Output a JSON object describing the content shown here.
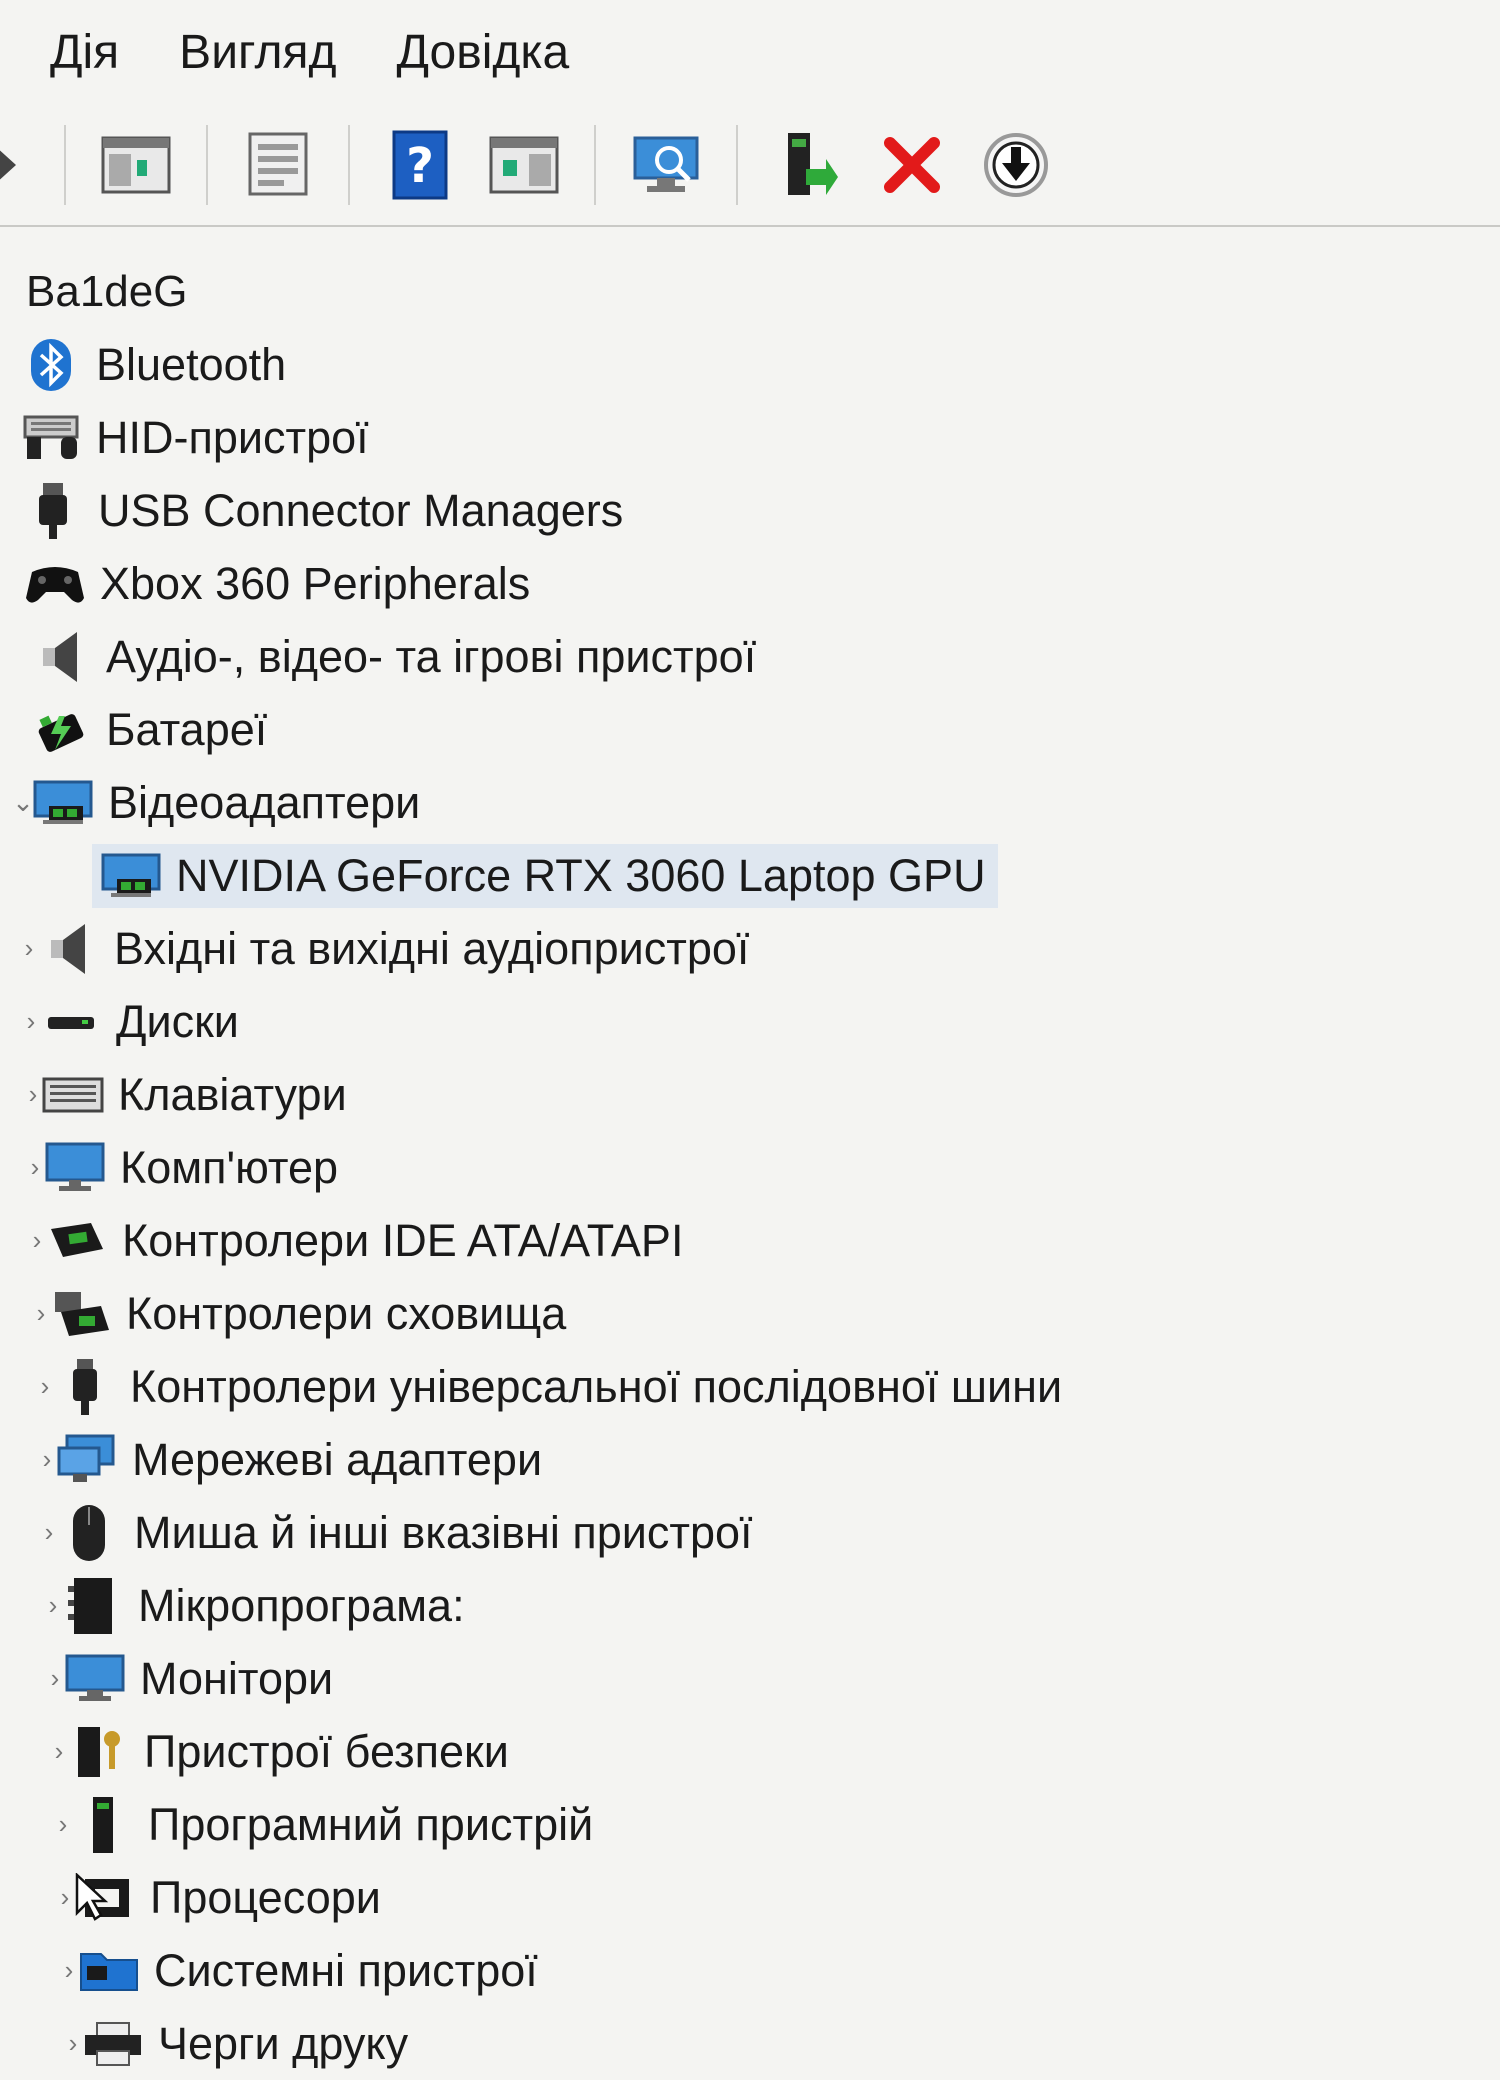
{
  "menu": {
    "action": "Дія",
    "view": "Вигляд",
    "help": "Довідка"
  },
  "tree": {
    "root": "Ba1deG",
    "items": [
      {
        "label": "Bluetooth",
        "icon": "bluetooth-icon"
      },
      {
        "label": "HID-пристрої",
        "icon": "hid-icon"
      },
      {
        "label": "USB Connector Managers",
        "icon": "usb-connector-icon"
      },
      {
        "label": "Xbox 360 Peripherals",
        "icon": "gamepad-icon"
      },
      {
        "label": "Аудіо-, відео- та ігрові пристрої",
        "icon": "speaker-icon"
      },
      {
        "label": "Батареї",
        "icon": "battery-icon"
      },
      {
        "label": "Відеоадаптери",
        "icon": "display-adapter-icon"
      },
      {
        "label": "NVIDIA GeForce RTX 3060 Laptop GPU",
        "icon": "display-adapter-icon"
      },
      {
        "label": "Вхідні та вихідні аудіопристрої",
        "icon": "speaker-icon"
      },
      {
        "label": "Диски",
        "icon": "disk-icon"
      },
      {
        "label": "Клавіатури",
        "icon": "keyboard-icon"
      },
      {
        "label": "Комп'ютер",
        "icon": "computer-icon"
      },
      {
        "label": "Контролери IDE ATA/ATAPI",
        "icon": "ide-controller-icon"
      },
      {
        "label": "Контролери сховища",
        "icon": "storage-controller-icon"
      },
      {
        "label": "Контролери універсальної послідовної шини",
        "icon": "usb-controller-icon"
      },
      {
        "label": "Мережеві адаптери",
        "icon": "network-adapter-icon"
      },
      {
        "label": "Миша й інші вказівні пристрої",
        "icon": "mouse-icon"
      },
      {
        "label": "Мікропрограма:",
        "icon": "firmware-icon"
      },
      {
        "label": "Монітори",
        "icon": "monitor-icon"
      },
      {
        "label": "Пристрої безпеки",
        "icon": "security-device-icon"
      },
      {
        "label": "Програмний пристрій",
        "icon": "software-device-icon"
      },
      {
        "label": "Процесори",
        "icon": "processor-icon"
      },
      {
        "label": "Системні пристрої",
        "icon": "system-devices-icon"
      },
      {
        "label": "Черги друку",
        "icon": "print-queue-icon"
      }
    ]
  },
  "colors": {
    "selection": "#dfe7f0",
    "delete_red": "#e21a1a",
    "help_blue": "#1d5fc2"
  }
}
